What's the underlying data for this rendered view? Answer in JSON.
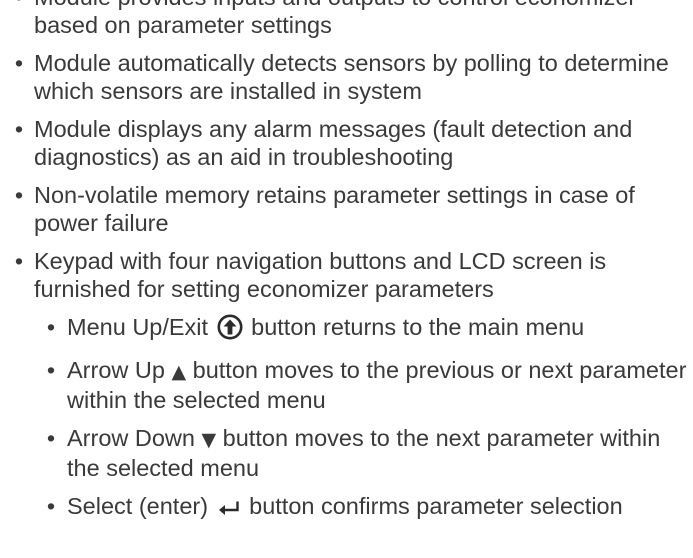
{
  "bullets": [
    {
      "text": "Module provides inputs and outputs to control economizer based on parameter settings"
    },
    {
      "text": "Module automatically detects sensors by polling to determine which sensors are installed in system"
    },
    {
      "text": "Module displays any alarm messages (fault detection and diagnostics) as an aid in troubleshooting"
    },
    {
      "text": "Non-volatile memory retains parameter settings in case of power failure"
    },
    {
      "text": "Keypad with four navigation buttons and LCD screen is furnished for setting economizer parameters"
    }
  ],
  "sub_bullets": [
    {
      "before": "Menu Up/Exit",
      "after": "button returns to the main menu",
      "icon": "menu-up-exit-icon"
    },
    {
      "before": "Arrow Up",
      "symbol": "▲",
      "after": "button moves to the previous or next parameter within the selected menu",
      "icon": "arrow-up-icon"
    },
    {
      "before": "Arrow Down",
      "symbol": "▼",
      "after": "button moves to the next parameter within the selected menu",
      "icon": "arrow-down-icon"
    },
    {
      "before": "Select (enter)",
      "after": "button confirms parameter selection",
      "icon": "enter-icon"
    }
  ],
  "bullet_char": "•"
}
